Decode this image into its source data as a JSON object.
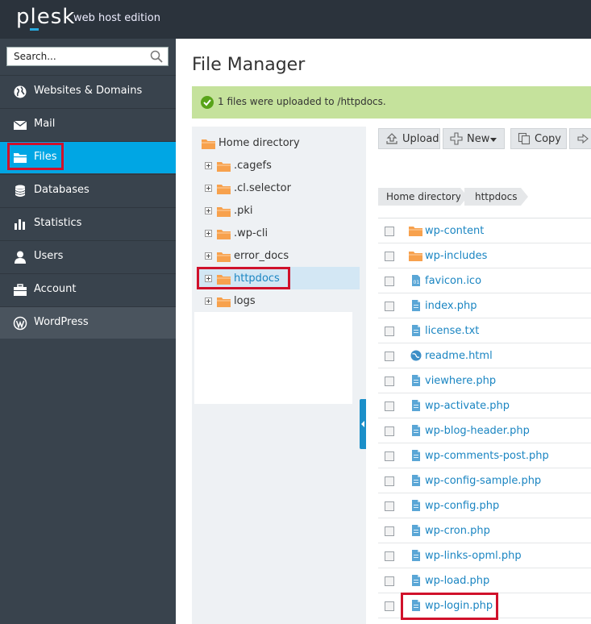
{
  "header": {
    "logo_text": "plesk",
    "edition": "web host edition"
  },
  "sidebar": {
    "search_placeholder": "Search...",
    "items": [
      {
        "label": "Websites & Domains",
        "icon": "globe-icon"
      },
      {
        "label": "Mail",
        "icon": "envelope-icon"
      },
      {
        "label": "Files",
        "icon": "folder-icon",
        "active": true
      },
      {
        "label": "Databases",
        "icon": "database-icon"
      },
      {
        "label": "Statistics",
        "icon": "bar-chart-icon"
      },
      {
        "label": "Users",
        "icon": "user-icon"
      },
      {
        "label": "Account",
        "icon": "briefcase-icon"
      },
      {
        "label": "WordPress",
        "icon": "wordpress-icon"
      }
    ]
  },
  "main": {
    "title": "File Manager",
    "message": "1 files were uploaded to /httpdocs."
  },
  "tree": {
    "root": "Home directory",
    "items": [
      ".cagefs",
      ".cl.selector",
      ".pki",
      ".wp-cli",
      "error_docs",
      "httpdocs",
      "logs"
    ],
    "selected": "httpdocs"
  },
  "toolbar": {
    "upload": "Upload",
    "new": "New",
    "copy": "Copy"
  },
  "breadcrumb": [
    "Home directory",
    "httpdocs"
  ],
  "files": [
    {
      "name": "wp-content",
      "type": "folder"
    },
    {
      "name": "wp-includes",
      "type": "folder"
    },
    {
      "name": "favicon.ico",
      "type": "image"
    },
    {
      "name": "index.php",
      "type": "file"
    },
    {
      "name": "license.txt",
      "type": "file"
    },
    {
      "name": "readme.html",
      "type": "html"
    },
    {
      "name": "viewhere.php",
      "type": "file"
    },
    {
      "name": "wp-activate.php",
      "type": "file"
    },
    {
      "name": "wp-blog-header.php",
      "type": "file"
    },
    {
      "name": "wp-comments-post.php",
      "type": "file"
    },
    {
      "name": "wp-config-sample.php",
      "type": "file"
    },
    {
      "name": "wp-config.php",
      "type": "file"
    },
    {
      "name": "wp-cron.php",
      "type": "file"
    },
    {
      "name": "wp-links-opml.php",
      "type": "file"
    },
    {
      "name": "wp-load.php",
      "type": "file"
    },
    {
      "name": "wp-login.php",
      "type": "file"
    }
  ],
  "colors": {
    "header_bg": "#2b333c",
    "sidebar_bg": "#39434d",
    "active_blue": "#00a6e4",
    "success_bg": "#c5e29c",
    "link": "#1a85c2",
    "highlight_red": "#d0112b"
  }
}
